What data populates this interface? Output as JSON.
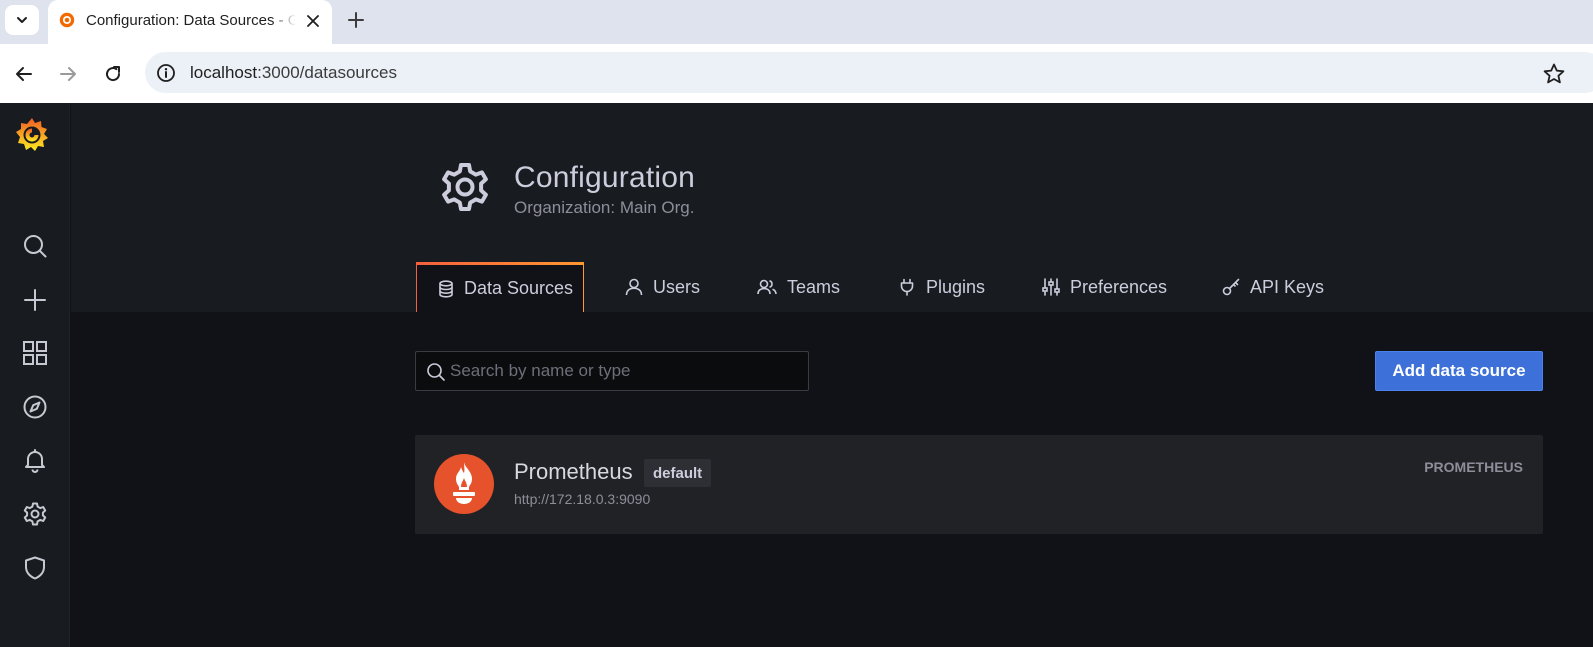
{
  "browser": {
    "tab": {
      "title": "Configuration: Data Sources - Grafana"
    },
    "address": {
      "host": "localhost",
      "path": ":3000/datasources"
    }
  },
  "sidebar": {
    "items": [
      {
        "name": "search",
        "icon": "search-icon"
      },
      {
        "name": "create",
        "icon": "plus-icon"
      },
      {
        "name": "dashboards",
        "icon": "apps-icon"
      },
      {
        "name": "explore",
        "icon": "compass-icon"
      },
      {
        "name": "alerting",
        "icon": "bell-icon"
      },
      {
        "name": "configuration",
        "icon": "cog-icon"
      },
      {
        "name": "server-admin",
        "icon": "shield-icon"
      }
    ]
  },
  "header": {
    "title": "Configuration",
    "subtitle": "Organization: Main Org."
  },
  "tabs": [
    {
      "label": "Data Sources",
      "icon": "database-icon",
      "active": true
    },
    {
      "label": "Users",
      "icon": "user-icon",
      "active": false
    },
    {
      "label": "Teams",
      "icon": "users-icon",
      "active": false
    },
    {
      "label": "Plugins",
      "icon": "plug-icon",
      "active": false
    },
    {
      "label": "Preferences",
      "icon": "sliders-icon",
      "active": false
    },
    {
      "label": "API Keys",
      "icon": "key-icon",
      "active": false
    }
  ],
  "toolbar": {
    "search_placeholder": "Search by name or type",
    "add_button": "Add data source"
  },
  "datasources": [
    {
      "name": "Prometheus",
      "badge": "default",
      "url": "http://172.18.0.3:9090",
      "type": "PROMETHEUS"
    }
  ],
  "colors": {
    "brand": "#f46800",
    "primary_button": "#3d71d9",
    "prometheus": "#e6522c",
    "background": "#111217"
  }
}
